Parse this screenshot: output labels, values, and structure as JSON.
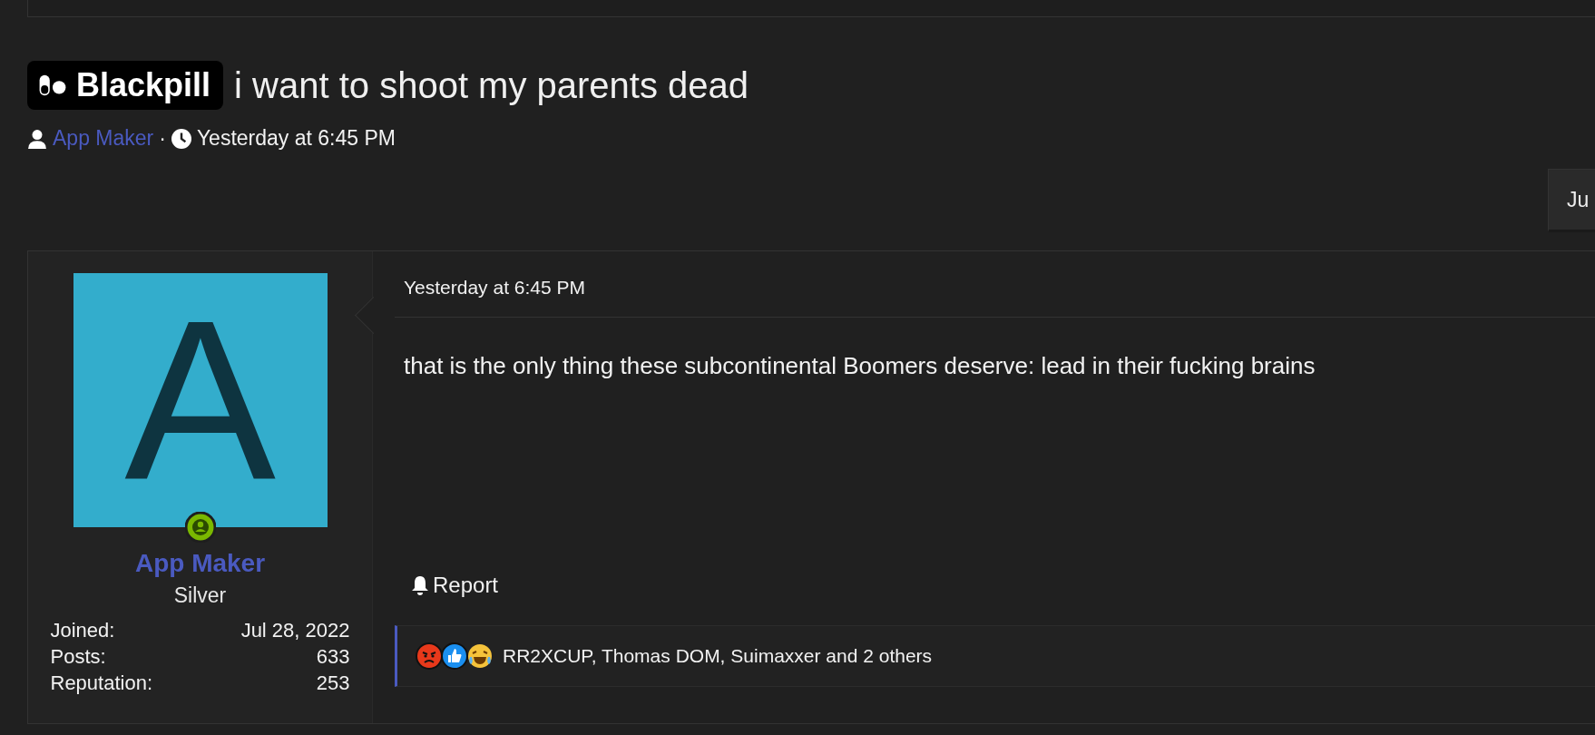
{
  "thread": {
    "prefix": "Blackpill",
    "title": "i want to shoot my parents dead",
    "author": "App Maker",
    "separator": "·",
    "time": "Yesterday at 6:45 PM"
  },
  "page_jump": {
    "label": "Ju"
  },
  "post": {
    "user": {
      "avatar_letter": "A",
      "name": "App Maker",
      "rank": "Silver",
      "online": true,
      "stats": [
        {
          "label": "Joined:",
          "value": "Jul 28, 2022"
        },
        {
          "label": "Posts:",
          "value": "633"
        },
        {
          "label": "Reputation:",
          "value": "253"
        }
      ]
    },
    "time": "Yesterday at 6:45 PM",
    "body": "that is the only thing these subcontinental Boomers deserve: lead in their fucking brains",
    "report": "Report",
    "reactions": {
      "icons": [
        {
          "kind": "angry"
        },
        {
          "kind": "like"
        },
        {
          "kind": "laugh"
        }
      ],
      "summary": "RR2XCUP, Thomas DOM, Suimaxxer and 2 others"
    }
  }
}
